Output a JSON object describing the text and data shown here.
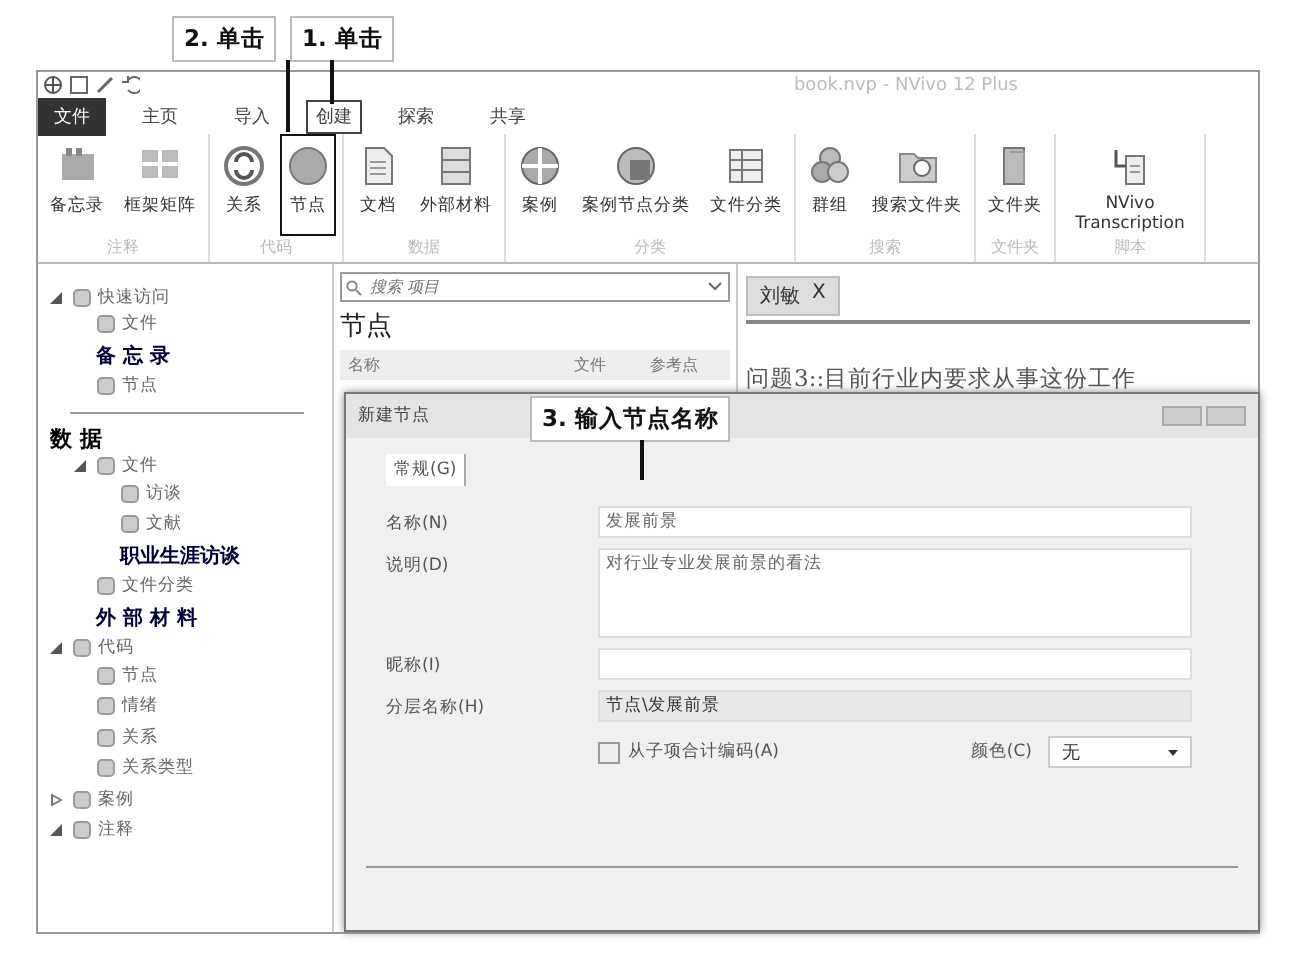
{
  "callouts": [
    {
      "text": "2. 单击"
    },
    {
      "text": "1. 单击"
    },
    {
      "text": "3. 输入节点名称"
    }
  ],
  "window": {
    "title": "book.nvp - NVivo 12 Plus"
  },
  "ribbon_tabs": [
    {
      "label": "文件",
      "kind": "file",
      "selected": false
    },
    {
      "label": "主页",
      "kind": "tab",
      "selected": false
    },
    {
      "label": "导入",
      "kind": "tab",
      "selected": false
    },
    {
      "label": "创建",
      "kind": "tab",
      "selected": true
    },
    {
      "label": "探索",
      "kind": "tab",
      "selected": false
    },
    {
      "label": "共享",
      "kind": "tab",
      "selected": false
    }
  ],
  "ribbon_groups": [
    {
      "label": "注释",
      "buttons": [
        {
          "label": "备忘录",
          "highlighted": false
        },
        {
          "label": "框架矩阵",
          "highlighted": false
        }
      ]
    },
    {
      "label": "代码",
      "buttons": [
        {
          "label": "关系",
          "highlighted": false
        },
        {
          "label": "节点",
          "highlighted": true
        }
      ]
    },
    {
      "label": "数据",
      "buttons": [
        {
          "label": "文档",
          "highlighted": false
        },
        {
          "label": "外部材料",
          "highlighted": false
        }
      ]
    },
    {
      "label": "分类",
      "buttons": [
        {
          "label": "案例",
          "highlighted": false
        },
        {
          "label": "案例节点分类",
          "highlighted": false
        },
        {
          "label": "文件分类",
          "highlighted": false
        }
      ]
    },
    {
      "label": "搜索",
      "buttons": [
        {
          "label": "群组",
          "highlighted": false
        },
        {
          "label": "搜索文件夹",
          "highlighted": false
        }
      ]
    },
    {
      "label": "文件夹",
      "buttons": [
        {
          "label": "文件夹",
          "highlighted": false
        }
      ]
    },
    {
      "label": "脚本",
      "buttons": [
        {
          "label": "NVivo Transcription",
          "highlighted": false
        }
      ]
    }
  ],
  "navigation": [
    {
      "label": "快速访问",
      "kind": "item",
      "expanded": true,
      "children": [
        {
          "label": "文件",
          "kind": "item"
        },
        {
          "label": "备 忘 录",
          "kind": "overlay"
        },
        {
          "label": "节点",
          "kind": "item"
        }
      ]
    },
    {
      "label": "数 据",
      "kind": "heading",
      "children": [
        {
          "label": "文件",
          "kind": "item",
          "expanded": true,
          "children": [
            {
              "label": "访谈",
              "kind": "item"
            },
            {
              "label": "文献",
              "kind": "item"
            },
            {
              "label": "职业生涯访谈",
              "kind": "overlay"
            }
          ]
        },
        {
          "label": "文件分类",
          "kind": "item"
        },
        {
          "label": "外 部 材 料",
          "kind": "overlay"
        }
      ]
    },
    {
      "label": "代码",
      "kind": "item",
      "expanded": true,
      "children": [
        {
          "label": "节点",
          "kind": "item"
        },
        {
          "label": "情绪",
          "kind": "item"
        },
        {
          "label": "关系",
          "kind": "item"
        },
        {
          "label": "关系类型",
          "kind": "item"
        }
      ]
    },
    {
      "label": "案例",
      "kind": "item",
      "expanded": false
    },
    {
      "label": "注释",
      "kind": "item",
      "expanded": true
    }
  ],
  "list_pane": {
    "search_placeholder": "搜索 项目",
    "title": "节点",
    "columns": [
      "名称",
      "文件",
      "参考点"
    ]
  },
  "document_tab": {
    "label": "刘敏",
    "close": "X"
  },
  "document_text": "问题3::目前行业内要求从事这份工作",
  "dialog": {
    "title": "新建节点",
    "tab": "常规(G)",
    "fields": [
      {
        "label": "名称(N)",
        "kind": "text",
        "value": "发展前景"
      },
      {
        "label": "说明(D)",
        "kind": "textarea",
        "value": "对行业专业发展前景的看法"
      },
      {
        "label": "昵称(I)",
        "kind": "text"
      },
      {
        "label": "分层名称(H)",
        "kind": "readonly",
        "value": "节点\\发展前景"
      }
    ],
    "checkbox": {
      "label": "从子项合计编码(A)",
      "checked": false
    },
    "color": {
      "label": "颜色(C)",
      "value": "无"
    }
  }
}
